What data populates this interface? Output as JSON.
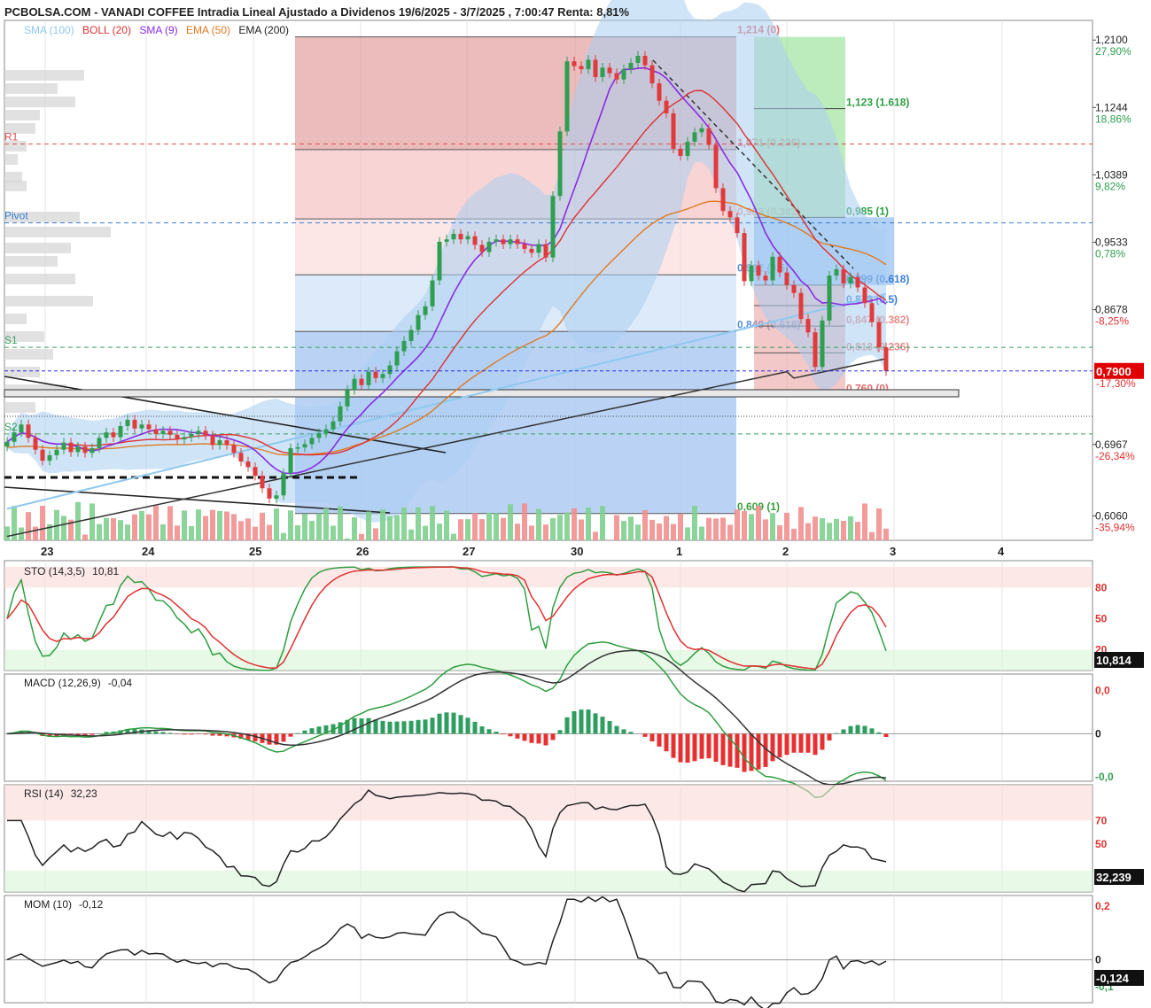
{
  "title": "PCBOLSA.COM - VANADI COFFEE Intradia Lineal Ajustado a Dividenos 19/6/2025 - 3/7/2025 , 7:00:47 Renta: 8,81%",
  "legend": [
    {
      "label": "SMA (100)",
      "color": "#8fc8ee"
    },
    {
      "label": "BOLL (20)",
      "color": "#e03030"
    },
    {
      "label": "SMA (9)",
      "color": "#8a2be2"
    },
    {
      "label": "EMA (50)",
      "color": "#e07a20"
    },
    {
      "label": "EMA (200)",
      "color": "#222222"
    }
  ],
  "colors": {
    "up": "#2e9e50",
    "down": "#e23a3a",
    "grid": "#e6e6e6",
    "current": "#e00000"
  },
  "chart_data": [
    {
      "type": "line",
      "name": "price",
      "x_ticks": [
        "23",
        "24",
        "25",
        "26",
        "27",
        "30",
        "1",
        "2",
        "3",
        "4"
      ],
      "ylim": [
        0.575,
        1.235
      ],
      "y_ticks": [
        {
          "value": "1,2100",
          "pct": "27,90%",
          "v": 1.21
        },
        {
          "value": "1,1244",
          "pct": "18,86%",
          "v": 1.1244
        },
        {
          "value": "1,0389",
          "pct": "9,82%",
          "v": 1.0389
        },
        {
          "value": "0,9533",
          "pct": "0,78%",
          "v": 0.9533
        },
        {
          "value": "0,8678",
          "pct": "-8,25%",
          "v": 0.8678
        },
        {
          "value": "0,6967",
          "pct": "-26,34%",
          "v": 0.6967
        },
        {
          "value": "0,6060",
          "pct": "-35,94%",
          "v": 0.606
        }
      ],
      "current": {
        "label": "0,7900",
        "pct": "-17,30%",
        "v": 0.79
      },
      "pivots": [
        {
          "label": "R1",
          "v": 1.078,
          "color": "#e05050"
        },
        {
          "label": "Pivot",
          "v": 0.978,
          "color": "#3a7fd6"
        },
        {
          "label": "S1",
          "v": 0.82,
          "color": "#3aa060"
        },
        {
          "label": "S2",
          "v": 0.71,
          "color": "#3aa060"
        }
      ],
      "fib_left": [
        {
          "label": "1,214 (0)",
          "v": 1.214
        },
        {
          "label": "1,071 (0.236)",
          "v": 1.071
        },
        {
          "label": "0,983 (0.382)",
          "v": 0.983
        },
        {
          "label": "0,912 (0.5)",
          "v": 0.912
        },
        {
          "label": "0,840 (0.618)",
          "v": 0.84
        },
        {
          "label": "0,609 (1)",
          "v": 0.609
        }
      ],
      "fib_right": [
        {
          "label": "1,123 (1.618)",
          "v": 1.123
        },
        {
          "label": "0,985 (1)",
          "v": 0.985
        },
        {
          "label": "0,899 (0.618)",
          "v": 0.899
        },
        {
          "label": "0,873 (0.5)",
          "v": 0.873
        },
        {
          "label": "0,847 (0.382)",
          "v": 0.847
        },
        {
          "label": "0,813 (0.236)",
          "v": 0.813
        },
        {
          "label": "0,760 (0)",
          "v": 0.76
        }
      ],
      "close": [
        0.7,
        0.712,
        0.722,
        0.705,
        0.69,
        0.676,
        0.683,
        0.69,
        0.699,
        0.687,
        0.694,
        0.686,
        0.692,
        0.705,
        0.712,
        0.706,
        0.72,
        0.728,
        0.717,
        0.722,
        0.716,
        0.71,
        0.714,
        0.709,
        0.703,
        0.706,
        0.71,
        0.714,
        0.708,
        0.696,
        0.702,
        0.696,
        0.686,
        0.675,
        0.668,
        0.657,
        0.641,
        0.628,
        0.632,
        0.66,
        0.692,
        0.693,
        0.697,
        0.705,
        0.711,
        0.716,
        0.726,
        0.745,
        0.766,
        0.78,
        0.772,
        0.789,
        0.781,
        0.786,
        0.797,
        0.815,
        0.828,
        0.842,
        0.861,
        0.872,
        0.905,
        0.954,
        0.957,
        0.964,
        0.957,
        0.961,
        0.95,
        0.941,
        0.954,
        0.957,
        0.951,
        0.957,
        0.951,
        0.945,
        0.94,
        0.951,
        0.934,
        1.012,
        1.094,
        1.183,
        1.177,
        1.173,
        1.185,
        1.163,
        1.175,
        1.168,
        1.16,
        1.173,
        1.181,
        1.19,
        1.178,
        1.155,
        1.133,
        1.117,
        1.072,
        1.063,
        1.081,
        1.093,
        1.098,
        1.077,
        1.022,
        0.993,
        0.985,
        0.965,
        0.904,
        0.924,
        0.911,
        0.905,
        0.935,
        0.915,
        0.899,
        0.889,
        0.856,
        0.839,
        0.795,
        0.854,
        0.911,
        0.919,
        0.901,
        0.909,
        0.896,
        0.876,
        0.852,
        0.82,
        0.79
      ],
      "open": [
        0.694,
        0.7,
        0.712,
        0.722,
        0.705,
        0.69,
        0.676,
        0.683,
        0.69,
        0.699,
        0.687,
        0.694,
        0.686,
        0.692,
        0.705,
        0.712,
        0.706,
        0.72,
        0.728,
        0.717,
        0.722,
        0.716,
        0.71,
        0.714,
        0.709,
        0.703,
        0.706,
        0.71,
        0.714,
        0.708,
        0.696,
        0.702,
        0.696,
        0.686,
        0.675,
        0.668,
        0.657,
        0.641,
        0.628,
        0.632,
        0.66,
        0.692,
        0.693,
        0.697,
        0.705,
        0.711,
        0.716,
        0.726,
        0.745,
        0.766,
        0.78,
        0.772,
        0.789,
        0.781,
        0.786,
        0.797,
        0.815,
        0.828,
        0.842,
        0.861,
        0.872,
        0.905,
        0.954,
        0.957,
        0.964,
        0.957,
        0.961,
        0.95,
        0.941,
        0.954,
        0.957,
        0.951,
        0.957,
        0.951,
        0.945,
        0.94,
        0.951,
        0.934,
        1.012,
        1.094,
        1.183,
        1.177,
        1.173,
        1.185,
        1.163,
        1.175,
        1.168,
        1.16,
        1.173,
        1.181,
        1.19,
        1.178,
        1.155,
        1.133,
        1.117,
        1.072,
        1.063,
        1.081,
        1.093,
        1.098,
        1.077,
        1.022,
        0.993,
        0.985,
        0.965,
        0.904,
        0.924,
        0.911,
        0.905,
        0.935,
        0.915,
        0.899,
        0.889,
        0.856,
        0.839,
        0.795,
        0.854,
        0.911,
        0.919,
        0.901,
        0.909,
        0.896,
        0.876,
        0.852,
        0.82
      ]
    },
    {
      "type": "line",
      "name": "STO (14,3,5)",
      "value": "10,81",
      "badge": "10,814",
      "ylim": [
        0,
        100
      ],
      "y_ticks": [
        {
          "value": "80",
          "v": 80
        },
        {
          "value": "50",
          "v": 50
        },
        {
          "value": "20",
          "v": 20
        }
      ]
    },
    {
      "type": "line",
      "name": "MACD (12,26,9)",
      "value": "-0,04",
      "y_ticks": [
        {
          "value": "0,0",
          "v": 1
        },
        {
          "value": "0",
          "v": 0
        },
        {
          "value": "-0,0",
          "v": -1
        }
      ]
    },
    {
      "type": "line",
      "name": "RSI (14)",
      "value": "32,23",
      "badge": "32,239",
      "ylim": [
        10,
        100
      ],
      "y_ticks": [
        {
          "value": "70",
          "v": 70
        },
        {
          "value": "50",
          "v": 50
        }
      ]
    },
    {
      "type": "line",
      "name": "MOM (10)",
      "value": "-0,12",
      "badge": "-0,124",
      "y_ticks": [
        {
          "value": "0,2",
          "v": 0.2
        },
        {
          "value": "0",
          "v": 0
        },
        {
          "value": "-0,1",
          "v": -0.1
        }
      ]
    }
  ]
}
